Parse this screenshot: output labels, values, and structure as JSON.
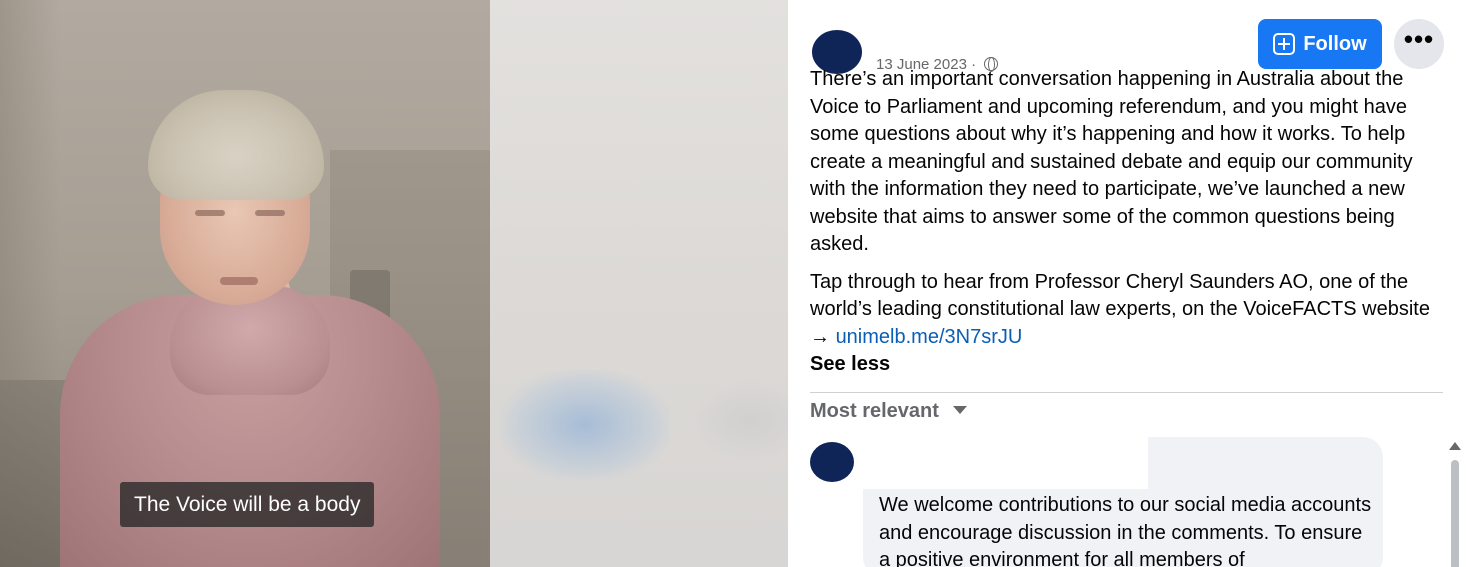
{
  "video": {
    "caption": "The Voice will be a body"
  },
  "post": {
    "date": "13 June 2023",
    "date_separator": "·",
    "visibility_icon": "globe-icon",
    "follow_label": "Follow",
    "more_icon": "more-icon",
    "more_glyph": "•••",
    "paragraph1": "There’s an important conversation happening in Australia about the Voice to Parliament and upcoming referendum, and you might have some questions about why it’s happening and how it works. To help create a meaningful and sustained debate and equip our community with the information they need to participate, we’ve launched a new website that aims to answer some of the common questions being asked.",
    "paragraph2": "Tap through to hear from Professor Cheryl Saunders AO, one of the world’s leading constitutional law experts, on the VoiceFACTS website",
    "arrow": "→",
    "link": "unimelb.me/3N7srJU",
    "see_less": "See less"
  },
  "comments": {
    "sort_label": "Most relevant",
    "first_comment_text": "We welcome contributions to our social media accounts and encourage discussion in the comments. To ensure a positive environment for all members of"
  },
  "colors": {
    "accent": "#1877f2",
    "link": "#0a5fb4",
    "secondary_text": "#65676b",
    "bubble": "#f0f2f5"
  }
}
